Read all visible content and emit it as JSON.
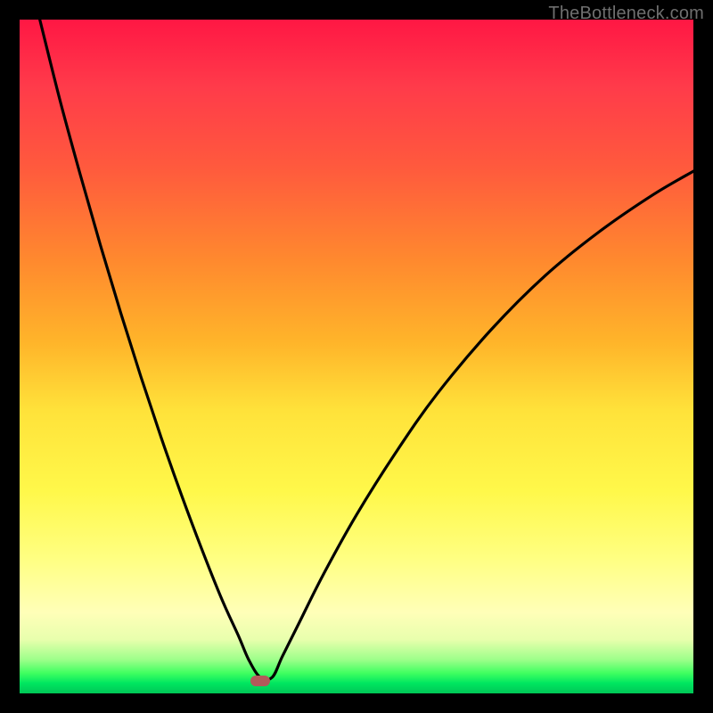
{
  "watermark": "TheBottleneck.com",
  "marker": {
    "x_pct": 35.7,
    "y_pct": 98.1
  },
  "colors": {
    "frame": "#000000",
    "curve": "#000000",
    "marker": "#b35a5a",
    "watermark": "#6f6f6f"
  },
  "chart_data": {
    "type": "line",
    "title": "",
    "xlabel": "",
    "ylabel": "",
    "xlim_pct": [
      0,
      100
    ],
    "ylim_pct": [
      0,
      100
    ],
    "note": "Axes are unlabeled in the source image; values below are normalized percentages of the plot area (x left→right, y top→bottom). The curve drops from top-left toward a minimum near x≈36, bottoms out, then rises with decreasing slope toward the right edge.",
    "series": [
      {
        "name": "bottleneck-curve",
        "points_pct": [
          [
            3.0,
            0.0
          ],
          [
            6.0,
            12.0
          ],
          [
            9.0,
            23.0
          ],
          [
            12.0,
            33.5
          ],
          [
            15.0,
            43.5
          ],
          [
            18.0,
            53.0
          ],
          [
            21.0,
            62.0
          ],
          [
            24.0,
            70.5
          ],
          [
            27.0,
            78.5
          ],
          [
            30.0,
            86.0
          ],
          [
            32.5,
            91.5
          ],
          [
            34.0,
            95.0
          ],
          [
            35.7,
            97.6
          ],
          [
            37.5,
            97.6
          ],
          [
            39.0,
            94.5
          ],
          [
            41.5,
            89.5
          ],
          [
            45.0,
            82.5
          ],
          [
            50.0,
            73.5
          ],
          [
            56.0,
            64.0
          ],
          [
            62.0,
            55.5
          ],
          [
            70.0,
            46.0
          ],
          [
            78.0,
            38.0
          ],
          [
            86.0,
            31.5
          ],
          [
            94.0,
            26.0
          ],
          [
            100.0,
            22.5
          ]
        ]
      }
    ],
    "marker_point_pct": {
      "x": 35.7,
      "y": 98.1
    },
    "background_gradient_stops": [
      {
        "pct": 0,
        "color": "#ff1744"
      },
      {
        "pct": 50,
        "color": "#ffd83a"
      },
      {
        "pct": 90,
        "color": "#ffffb0"
      },
      {
        "pct": 100,
        "color": "#00c656"
      }
    ]
  }
}
